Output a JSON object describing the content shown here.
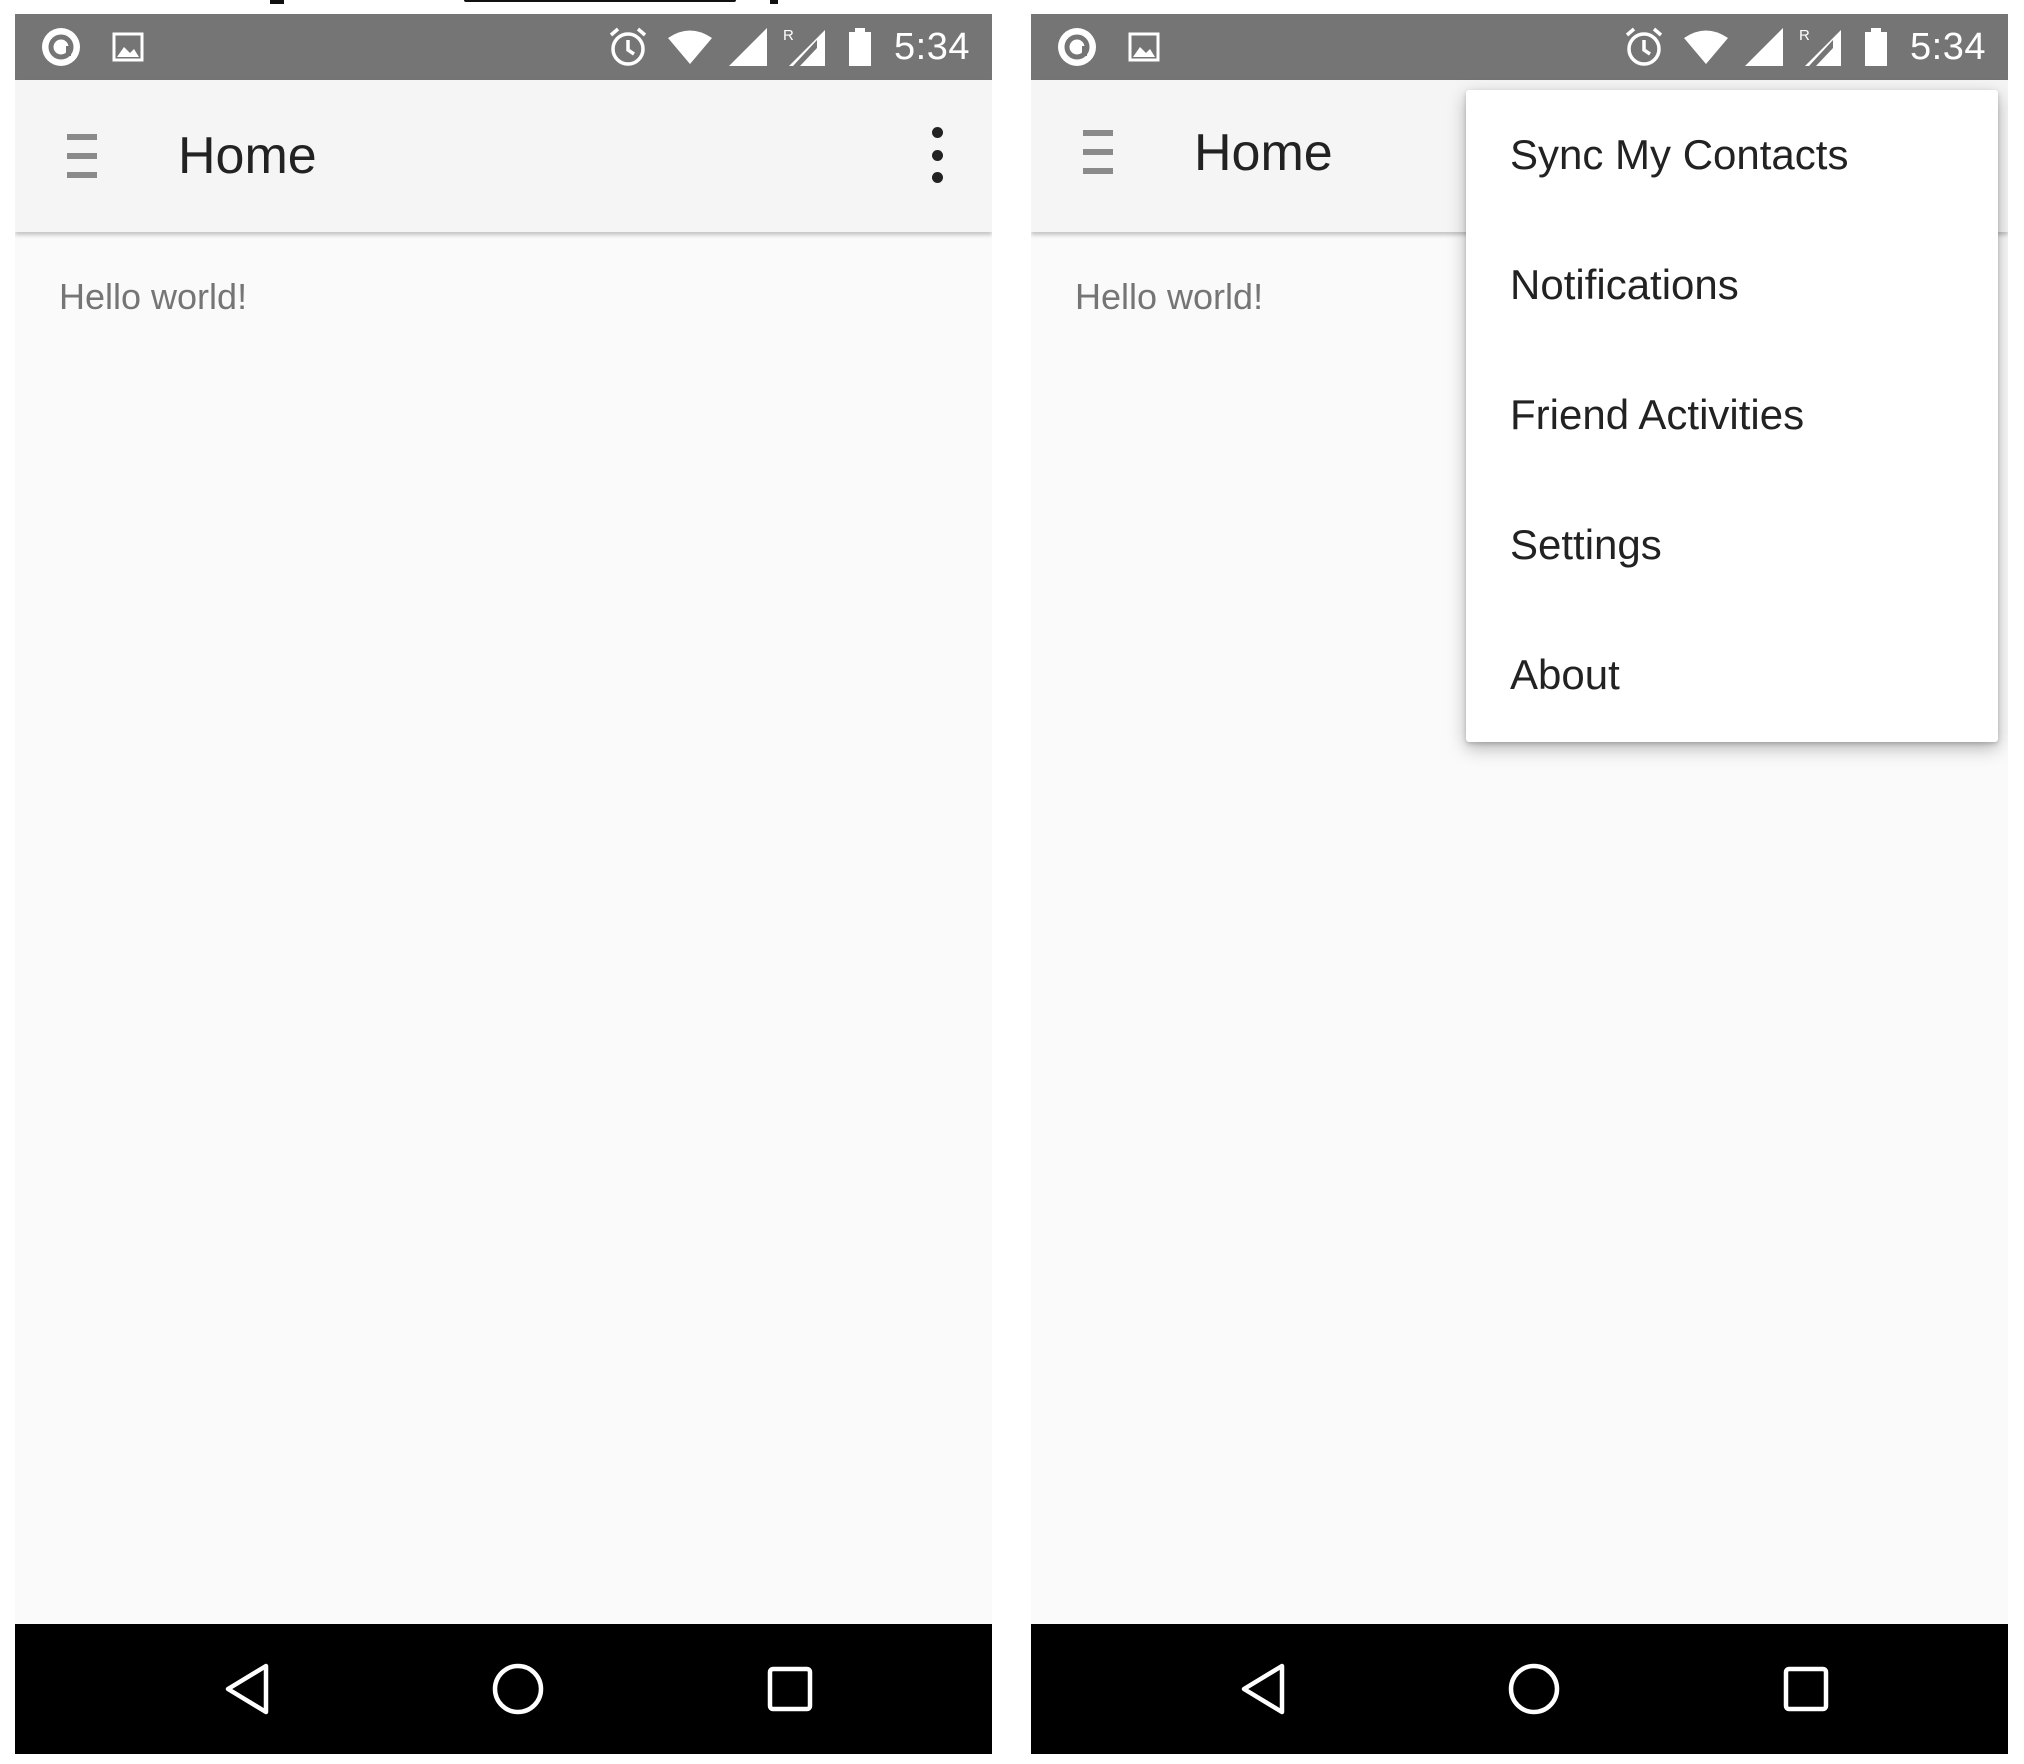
{
  "status_bar": {
    "time": "5:34",
    "left_icons": [
      "app-notification-icon",
      "image-notification-icon"
    ],
    "right_icons": [
      "alarm-icon",
      "wifi-icon",
      "cell-signal-icon",
      "roaming-signal-icon",
      "battery-icon"
    ],
    "roaming_letter": "R"
  },
  "app_bar": {
    "title": "Home"
  },
  "content": {
    "text": "Hello world!"
  },
  "overflow_menu": {
    "items": [
      {
        "label": "Sync My Contacts"
      },
      {
        "label": "Notifications"
      },
      {
        "label": "Friend Activities"
      },
      {
        "label": "Settings"
      },
      {
        "label": "About"
      }
    ]
  },
  "nav_bar": {
    "buttons": [
      "back-icon",
      "home-icon",
      "recents-icon"
    ]
  },
  "colors": {
    "status_bar": "#757575",
    "app_bar": "#f5f5f5",
    "background": "#fafafa",
    "nav_bar": "#000000",
    "menu": "#ffffff"
  }
}
